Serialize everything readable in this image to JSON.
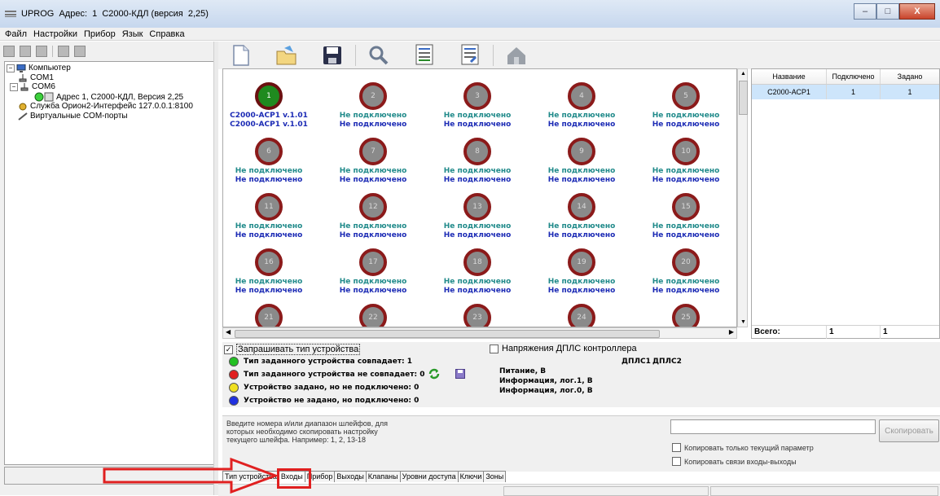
{
  "window": {
    "title": "UPROG  Адрес:  1  С2000-КДЛ (версия  2,25)",
    "controls": [
      "–",
      "□",
      "X"
    ]
  },
  "menu": [
    "Файл",
    "Настройки",
    "Прибор",
    "Язык",
    "Справка"
  ],
  "tree": {
    "computer": "Компьютер",
    "com1": "COM1",
    "com6": "COM6",
    "device": "Адрес 1, С2000-КДЛ, Версия 2,25",
    "service": "Служба Орион2-Интерфейс 127.0.0.1:8100",
    "virtual": "Виртуальные COM-порты"
  },
  "toolbar_icons": [
    "new-document-icon",
    "open-folder-icon",
    "save-icon",
    "search-icon",
    "read-config-icon",
    "write-config-icon",
    "home-icon"
  ],
  "cells": [
    {
      "num": "1",
      "line1": "С2000-АСР1  v.1.01",
      "line2": "С2000-АСР1  v.1.01",
      "on": true
    },
    {
      "num": "2",
      "line1": "Не подключено",
      "line2": "Не подключено",
      "on": false
    },
    {
      "num": "3",
      "line1": "Не подключено",
      "line2": "Не подключено",
      "on": false
    },
    {
      "num": "4",
      "line1": "Не подключено",
      "line2": "Не подключено",
      "on": false
    },
    {
      "num": "5",
      "line1": "Не подключено",
      "line2": "Не подключено",
      "on": false
    },
    {
      "num": "6",
      "line1": "Не подключено",
      "line2": "Не подключено",
      "on": false
    },
    {
      "num": "7",
      "line1": "Не подключено",
      "line2": "Не подключено",
      "on": false
    },
    {
      "num": "8",
      "line1": "Не подключено",
      "line2": "Не подключено",
      "on": false
    },
    {
      "num": "9",
      "line1": "Не подключено",
      "line2": "Не подключено",
      "on": false
    },
    {
      "num": "10",
      "line1": "Не подключено",
      "line2": "Не подключено",
      "on": false
    },
    {
      "num": "11",
      "line1": "Не подключено",
      "line2": "Не подключено",
      "on": false
    },
    {
      "num": "12",
      "line1": "Не подключено",
      "line2": "Не подключено",
      "on": false
    },
    {
      "num": "13",
      "line1": "Не подключено",
      "line2": "Не подключено",
      "on": false
    },
    {
      "num": "14",
      "line1": "Не подключено",
      "line2": "Не подключено",
      "on": false
    },
    {
      "num": "15",
      "line1": "Не подключено",
      "line2": "Не подключено",
      "on": false
    },
    {
      "num": "16",
      "line1": "Не подключено",
      "line2": "Не подключено",
      "on": false
    },
    {
      "num": "17",
      "line1": "Не подключено",
      "line2": "Не подключено",
      "on": false
    },
    {
      "num": "18",
      "line1": "Не подключено",
      "line2": "Не подключено",
      "on": false
    },
    {
      "num": "19",
      "line1": "Не подключено",
      "line2": "Не подключено",
      "on": false
    },
    {
      "num": "20",
      "line1": "Не подключено",
      "line2": "Не подключено",
      "on": false
    },
    {
      "num": "21",
      "line1": "",
      "line2": "",
      "on": false
    },
    {
      "num": "22",
      "line1": "",
      "line2": "",
      "on": false
    },
    {
      "num": "23",
      "line1": "",
      "line2": "",
      "on": false
    },
    {
      "num": "24",
      "line1": "",
      "line2": "",
      "on": false
    },
    {
      "num": "25",
      "line1": "",
      "line2": "",
      "on": false
    }
  ],
  "right_table": {
    "headers": [
      "Название",
      "Подключено",
      "Задано"
    ],
    "row": [
      "С2000-АСР1",
      "1",
      "1"
    ],
    "total": [
      "Всего:",
      "1",
      "1"
    ]
  },
  "status": {
    "query_type": "Запрашивать тип устройства",
    "query_checked": "✓",
    "match": "Тип заданного устройства совпадает:  1",
    "mismatch": "Тип заданного устройства не совпадает: 0",
    "set_not_connected": "Устройство задано, но не подключено: 0",
    "not_set_connected": "Устройство не задано, но подключено: 0",
    "dpls_voltage": "Напряжения ДПЛС контроллера",
    "dpls1": "ДПЛС1",
    "dpls2": "ДПЛС2",
    "power": "Питание, В",
    "info1": "Информация, лог.1, В",
    "info0": "Информация, лог.0, В",
    "colors": {
      "match": "#22c022",
      "mismatch": "#e02020",
      "set_not_connected": "#f0e020",
      "not_set_connected": "#2030e0"
    }
  },
  "copy": {
    "help": "Введите номера и/или диапазон шлейфов, для которых необходимо скопировать настройку текущего шлейфа. Например: 1, 2, 13-18",
    "input_value": "",
    "button": "Скопировать",
    "opt1": "Копировать только текущий параметр",
    "opt2": "Копировать связи входы-выходы"
  },
  "tabs": [
    "Тип устройства",
    "Входы",
    "Прибор",
    "Выходы",
    "Клапаны",
    "Уровни доступа",
    "Ключи",
    "Зоны"
  ]
}
